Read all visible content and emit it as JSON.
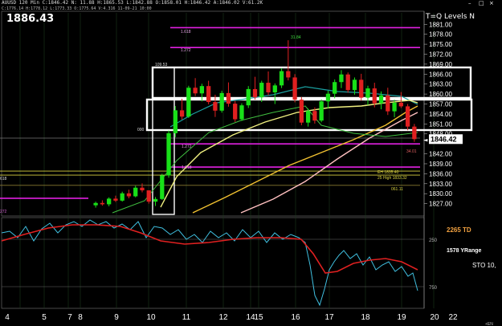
{
  "header": {
    "line1": "AUUSD 120 Min  C:1846.42  N:  11.88  H:1865.53  L:1842.88  O:1858.01  H:1846.42  A:1846.02  V:61.2K",
    "line2": "C:1776.14 H:1778.12 L:1773.33 O:1775.64 V:4.316 11-09-21 10:00"
  },
  "last_price_big": "1886.43",
  "study_title": "T=Q Levels N",
  "window_buttons": [
    "–",
    "□",
    "×"
  ],
  "price_axis": {
    "labels": [
      "1881.00",
      "1878.00",
      "1875.00",
      "1872.00",
      "1869.00",
      "1866.00",
      "1863.00",
      "1860.00",
      "1857.00",
      "1854.00",
      "1851.00",
      "1848.00",
      "1842.00",
      "1839.00",
      "1836.00",
      "1833.00",
      "1830.00",
      "1827.00"
    ],
    "current": "1846.42"
  },
  "date_axis": [
    "4",
    "5",
    "7",
    "8",
    "9",
    "10",
    "11",
    "12",
    "14",
    "15",
    "16",
    "17",
    "18",
    "19",
    "20",
    "22"
  ],
  "level_labels": {
    "fib_1": "1.618",
    "fib_2": "1.272",
    "fib_3": "1.272",
    "fib_4": "1.618",
    "peak": "31.84",
    "box_top": "109.53",
    "start": "000",
    "low_tag": "34.01",
    "low_tag2": "272",
    "left_tag": "618",
    "r1": "EH 1835.40",
    "r2": "25 High 1833.32",
    "r3": "061.11"
  },
  "osc": {
    "td_label": "2265 TD",
    "yrange_label": "1578 YRange",
    "sto_label": "STO  10,",
    "ticks": [
      "250",
      "750"
    ],
    "axis_left": "+EN"
  },
  "chart_data": {
    "type": "candlestick",
    "title": "",
    "ylim": [
      1824,
      1883
    ],
    "x_ticks": [
      "4",
      "5",
      "7",
      "8",
      "9",
      "10",
      "11",
      "12",
      "14",
      "15",
      "16",
      "17",
      "18",
      "19",
      "20",
      "22"
    ],
    "last": 1846.42,
    "candles": [
      [
        1826.5,
        1827.6,
        1825.8,
        1827.2
      ],
      [
        1827.2,
        1828.0,
        1826.4,
        1826.8
      ],
      [
        1826.8,
        1828.9,
        1826.2,
        1828.5
      ],
      [
        1828.5,
        1829.4,
        1827.5,
        1827.9
      ],
      [
        1827.9,
        1830.6,
        1827.6,
        1830.1
      ],
      [
        1830.1,
        1831.2,
        1828.6,
        1829.2
      ],
      [
        1829.2,
        1832.4,
        1828.9,
        1831.8
      ],
      [
        1831.8,
        1833.1,
        1830.4,
        1831.0
      ],
      [
        1831.0,
        1829.5,
        1827.0,
        1827.6
      ],
      [
        1827.6,
        1829.0,
        1826.3,
        1828.4
      ],
      [
        1828.4,
        1836.0,
        1828.1,
        1835.5
      ],
      [
        1835.5,
        1849.0,
        1834.8,
        1848.2
      ],
      [
        1848.2,
        1856.4,
        1847.0,
        1855.1
      ],
      [
        1855.1,
        1858.6,
        1852.3,
        1853.2
      ],
      [
        1853.2,
        1862.5,
        1852.8,
        1861.9
      ],
      [
        1861.9,
        1864.8,
        1859.4,
        1860.2
      ],
      [
        1860.2,
        1863.1,
        1857.8,
        1862.4
      ],
      [
        1862.4,
        1864.0,
        1856.9,
        1857.6
      ],
      [
        1857.6,
        1859.8,
        1853.1,
        1855.0
      ],
      [
        1855.0,
        1861.0,
        1854.4,
        1860.3
      ],
      [
        1860.3,
        1863.5,
        1856.2,
        1857.1
      ],
      [
        1857.1,
        1858.0,
        1851.6,
        1852.4
      ],
      [
        1852.4,
        1857.2,
        1851.9,
        1856.6
      ],
      [
        1856.6,
        1862.4,
        1855.8,
        1861.5
      ],
      [
        1861.5,
        1865.2,
        1858.3,
        1859.0
      ],
      [
        1859.0,
        1864.0,
        1857.6,
        1863.4
      ],
      [
        1863.4,
        1866.8,
        1859.6,
        1860.5
      ],
      [
        1860.5,
        1863.2,
        1857.0,
        1862.6
      ],
      [
        1862.6,
        1867.8,
        1861.8,
        1866.9
      ],
      [
        1866.9,
        1876.2,
        1864.1,
        1865.0
      ],
      [
        1865.0,
        1866.0,
        1857.5,
        1858.3
      ],
      [
        1858.3,
        1859.1,
        1850.6,
        1851.4
      ],
      [
        1851.4,
        1855.6,
        1850.2,
        1854.9
      ],
      [
        1854.9,
        1856.0,
        1851.1,
        1852.0
      ],
      [
        1852.0,
        1858.4,
        1851.5,
        1857.8
      ],
      [
        1857.8,
        1861.0,
        1855.6,
        1860.1
      ],
      [
        1860.1,
        1864.4,
        1858.7,
        1863.6
      ],
      [
        1863.6,
        1867.2,
        1861.8,
        1865.9
      ],
      [
        1865.9,
        1866.5,
        1860.4,
        1861.2
      ],
      [
        1861.2,
        1865.0,
        1859.8,
        1864.3
      ],
      [
        1864.3,
        1866.1,
        1858.0,
        1858.9
      ],
      [
        1858.9,
        1862.5,
        1856.7,
        1861.7
      ],
      [
        1861.7,
        1863.4,
        1856.0,
        1857.2
      ],
      [
        1857.2,
        1860.8,
        1855.4,
        1859.6
      ],
      [
        1859.6,
        1861.9,
        1853.7,
        1854.8
      ],
      [
        1854.8,
        1858.3,
        1853.0,
        1857.4
      ],
      [
        1857.4,
        1860.6,
        1855.8,
        1856.3
      ],
      [
        1856.3,
        1857.0,
        1849.1,
        1850.2
      ],
      [
        1850.2,
        1851.0,
        1845.6,
        1846.42
      ]
    ],
    "levels_magenta": [
      1880.0,
      1874.0,
      1845.0,
      1838.0,
      1828.6
    ],
    "levels_yellow": [
      1836.8,
      1835.6,
      1832.5
    ],
    "osc_ylim": [
      0,
      1000
    ]
  }
}
